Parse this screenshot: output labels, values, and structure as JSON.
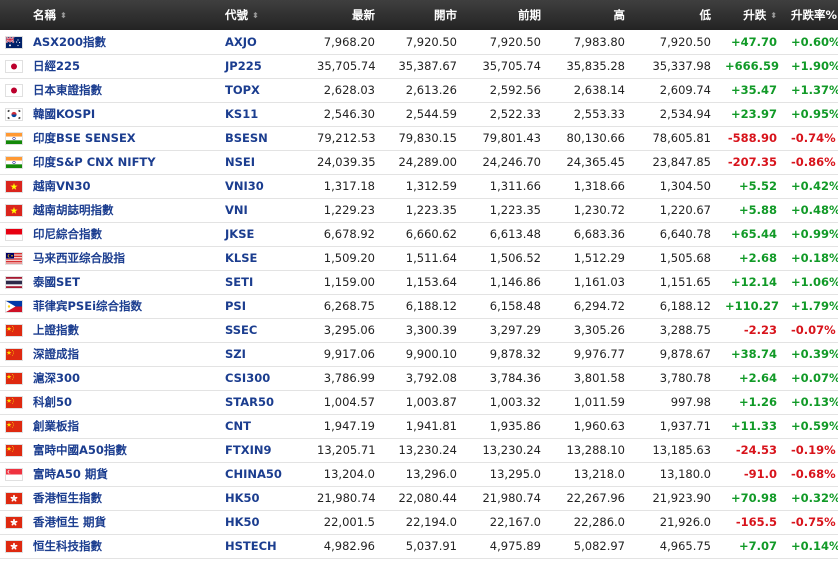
{
  "headers": {
    "name": "名稱",
    "code": "代號",
    "last": "最新",
    "open": "開市",
    "prev": "前期",
    "high": "高",
    "low": "低",
    "change": "升跌",
    "change_pct": "升跌率%"
  },
  "sort_glyph": "⬍",
  "colors": {
    "up": "#119a27",
    "down": "#d8141c",
    "link": "#1b3d8f",
    "header_bg": "#2f2f2f"
  },
  "rows": [
    {
      "flag": "australia",
      "name": "ASX200指數",
      "code": "AXJO",
      "last": "7,968.20",
      "open": "7,920.50",
      "prev": "7,920.50",
      "high": "7,983.80",
      "low": "7,920.50",
      "change": "+47.70",
      "change_pct": "+0.60%",
      "dir": "up"
    },
    {
      "flag": "japan",
      "name": "日經225",
      "code": "JP225",
      "last": "35,705.74",
      "open": "35,387.67",
      "prev": "35,705.74",
      "high": "35,835.28",
      "low": "35,337.98",
      "change": "+666.59",
      "change_pct": "+1.90%",
      "dir": "up"
    },
    {
      "flag": "japan",
      "name": "日本東證指數",
      "code": "TOPX",
      "last": "2,628.03",
      "open": "2,613.26",
      "prev": "2,592.56",
      "high": "2,638.14",
      "low": "2,609.74",
      "change": "+35.47",
      "change_pct": "+1.37%",
      "dir": "up"
    },
    {
      "flag": "korea",
      "name": "韓國KOSPI",
      "code": "KS11",
      "last": "2,546.30",
      "open": "2,544.59",
      "prev": "2,522.33",
      "high": "2,553.33",
      "low": "2,534.94",
      "change": "+23.97",
      "change_pct": "+0.95%",
      "dir": "up"
    },
    {
      "flag": "india",
      "name": "印度BSE SENSEX",
      "code": "BSESN",
      "last": "79,212.53",
      "open": "79,830.15",
      "prev": "79,801.43",
      "high": "80,130.66",
      "low": "78,605.81",
      "change": "-588.90",
      "change_pct": "-0.74%",
      "dir": "down"
    },
    {
      "flag": "india",
      "name": "印度S&P CNX NIFTY",
      "code": "NSEI",
      "last": "24,039.35",
      "open": "24,289.00",
      "prev": "24,246.70",
      "high": "24,365.45",
      "low": "23,847.85",
      "change": "-207.35",
      "change_pct": "-0.86%",
      "dir": "down"
    },
    {
      "flag": "vietnam",
      "name": "越南VN30",
      "code": "VNI30",
      "last": "1,317.18",
      "open": "1,312.59",
      "prev": "1,311.66",
      "high": "1,318.66",
      "low": "1,304.50",
      "change": "+5.52",
      "change_pct": "+0.42%",
      "dir": "up"
    },
    {
      "flag": "vietnam",
      "name": "越南胡誌明指數",
      "code": "VNI",
      "last": "1,229.23",
      "open": "1,223.35",
      "prev": "1,223.35",
      "high": "1,230.72",
      "low": "1,220.67",
      "change": "+5.88",
      "change_pct": "+0.48%",
      "dir": "up"
    },
    {
      "flag": "indonesia",
      "name": "印尼綜合指數",
      "code": "JKSE",
      "last": "6,678.92",
      "open": "6,660.62",
      "prev": "6,613.48",
      "high": "6,683.36",
      "low": "6,640.78",
      "change": "+65.44",
      "change_pct": "+0.99%",
      "dir": "up"
    },
    {
      "flag": "malaysia",
      "name": "马来西亚综合股指",
      "code": "KLSE",
      "last": "1,509.20",
      "open": "1,511.64",
      "prev": "1,506.52",
      "high": "1,512.29",
      "low": "1,505.68",
      "change": "+2.68",
      "change_pct": "+0.18%",
      "dir": "up"
    },
    {
      "flag": "thailand",
      "name": "泰國SET",
      "code": "SETI",
      "last": "1,159.00",
      "open": "1,153.64",
      "prev": "1,146.86",
      "high": "1,161.03",
      "low": "1,151.65",
      "change": "+12.14",
      "change_pct": "+1.06%",
      "dir": "up"
    },
    {
      "flag": "philippines",
      "name": "菲律宾PSEi综合指数",
      "code": "PSI",
      "last": "6,268.75",
      "open": "6,188.12",
      "prev": "6,158.48",
      "high": "6,294.72",
      "low": "6,188.12",
      "change": "+110.27",
      "change_pct": "+1.79%",
      "dir": "up"
    },
    {
      "flag": "china",
      "name": "上證指數",
      "code": "SSEC",
      "last": "3,295.06",
      "open": "3,300.39",
      "prev": "3,297.29",
      "high": "3,305.26",
      "low": "3,288.75",
      "change": "-2.23",
      "change_pct": "-0.07%",
      "dir": "down"
    },
    {
      "flag": "china",
      "name": "深證成指",
      "code": "SZI",
      "last": "9,917.06",
      "open": "9,900.10",
      "prev": "9,878.32",
      "high": "9,976.77",
      "low": "9,878.67",
      "change": "+38.74",
      "change_pct": "+0.39%",
      "dir": "up"
    },
    {
      "flag": "china",
      "name": "滬深300",
      "code": "CSI300",
      "last": "3,786.99",
      "open": "3,792.08",
      "prev": "3,784.36",
      "high": "3,801.58",
      "low": "3,780.78",
      "change": "+2.64",
      "change_pct": "+0.07%",
      "dir": "up"
    },
    {
      "flag": "china",
      "name": "科創50",
      "code": "STAR50",
      "last": "1,004.57",
      "open": "1,003.87",
      "prev": "1,003.32",
      "high": "1,011.59",
      "low": "997.98",
      "change": "+1.26",
      "change_pct": "+0.13%",
      "dir": "up"
    },
    {
      "flag": "china",
      "name": "創業板指",
      "code": "CNT",
      "last": "1,947.19",
      "open": "1,941.81",
      "prev": "1,935.86",
      "high": "1,960.63",
      "low": "1,937.71",
      "change": "+11.33",
      "change_pct": "+0.59%",
      "dir": "up"
    },
    {
      "flag": "china",
      "name": "富時中國A50指數",
      "code": "FTXIN9",
      "last": "13,205.71",
      "open": "13,230.24",
      "prev": "13,230.24",
      "high": "13,288.10",
      "low": "13,185.63",
      "change": "-24.53",
      "change_pct": "-0.19%",
      "dir": "down"
    },
    {
      "flag": "singapore",
      "name": "富時A50 期貨",
      "code": "CHINA50",
      "last": "13,204.0",
      "open": "13,296.0",
      "prev": "13,295.0",
      "high": "13,218.0",
      "low": "13,180.0",
      "change": "-91.0",
      "change_pct": "-0.68%",
      "dir": "down"
    },
    {
      "flag": "hongkong",
      "name": "香港恒生指數",
      "code": "HK50",
      "last": "21,980.74",
      "open": "22,080.44",
      "prev": "21,980.74",
      "high": "22,267.96",
      "low": "21,923.90",
      "change": "+70.98",
      "change_pct": "+0.32%",
      "dir": "up"
    },
    {
      "flag": "hongkong",
      "name": "香港恒生 期貨",
      "code": "HK50",
      "last": "22,001.5",
      "open": "22,194.0",
      "prev": "22,167.0",
      "high": "22,286.0",
      "low": "21,926.0",
      "change": "-165.5",
      "change_pct": "-0.75%",
      "dir": "down"
    },
    {
      "flag": "hongkong",
      "name": "恒生科技指數",
      "code": "HSTECH",
      "last": "4,982.96",
      "open": "5,037.91",
      "prev": "4,975.89",
      "high": "5,082.97",
      "low": "4,965.75",
      "change": "+7.07",
      "change_pct": "+0.14%",
      "dir": "up"
    }
  ]
}
